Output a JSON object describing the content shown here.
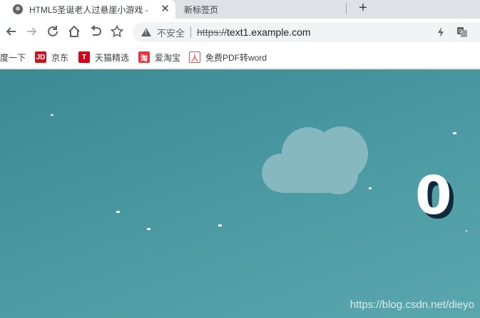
{
  "tabs": [
    {
      "title": "HTML5圣诞老人过悬崖小游戏 -",
      "active": true
    },
    {
      "title": "新标签页",
      "active": false
    }
  ],
  "toolbar": {
    "security_label": "不安全",
    "url_scheme": "https://",
    "url_host": "text1.example.com"
  },
  "bookmarks": [
    {
      "label": "度一下",
      "icon": "baidu-icon"
    },
    {
      "label": "京东",
      "icon": "jd-icon",
      "badge": "JD",
      "color": "#c9151e"
    },
    {
      "label": "天猫精选",
      "icon": "tmall-icon",
      "badge": "T",
      "color": "#d0021b"
    },
    {
      "label": "爱淘宝",
      "icon": "taobao-icon",
      "badge": "淘",
      "color": "#e4393c"
    },
    {
      "label": "免费PDF转word",
      "icon": "pdf-icon",
      "badge": "人",
      "color": "#e45454"
    }
  ],
  "game": {
    "score": "0",
    "watermark": "https://blog.csdn.net/dieyo",
    "background_color": "#4593a0",
    "cloud_color": "#86b8c0",
    "score_shadow_color": "#0e2a3c"
  }
}
